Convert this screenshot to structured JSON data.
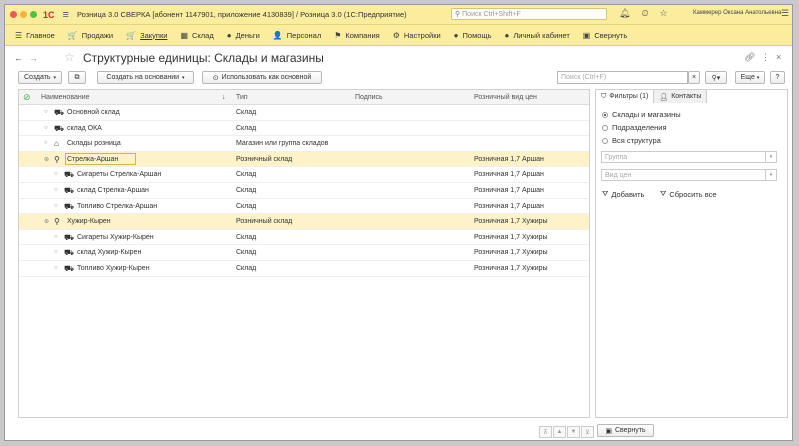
{
  "window": {
    "title": "Розница 3.0 СВЕРКА [абонент 1147901, приложение 4130839] / Розница 3.0  (1С:Предприятие)",
    "search_placeholder": "Поиск Ctrl+Shift+F",
    "user": "Каммерер Оксана Анатольевна"
  },
  "sections": [
    {
      "icon": "☰",
      "label": "Главное"
    },
    {
      "icon": "🛒",
      "label": "Продажи"
    },
    {
      "icon": "🛒",
      "label": "Закупки",
      "active": true
    },
    {
      "icon": "▦",
      "label": "Склад"
    },
    {
      "icon": "●",
      "label": "Деньги"
    },
    {
      "icon": "👤",
      "label": "Персонал"
    },
    {
      "icon": "⚑",
      "label": "Компания"
    },
    {
      "icon": "⚙",
      "label": "Настройки"
    },
    {
      "icon": "●",
      "label": "Помощь"
    },
    {
      "icon": "●",
      "label": "Личный кабинет"
    },
    {
      "icon": "▣",
      "label": "Свернуть"
    }
  ],
  "form": {
    "title": "Структурные единицы: Склады и магазины",
    "create_label": "Создать",
    "create_based_label": "Создать на основании",
    "use_as_main_label": "Использовать как основной",
    "search_placeholder": "Поиск (Ctrl+F)",
    "more_label": "Еще",
    "help_label": "?"
  },
  "table": {
    "columns": {
      "name": "Наименование",
      "type": "Тип",
      "signature": "Подпись",
      "price_type": "Розничный вид цен"
    },
    "rows": [
      {
        "name": "Основной склад",
        "type": "Склад",
        "price": "",
        "level": 0,
        "icon": "warehouse",
        "shop": false
      },
      {
        "name": "склад ОКА",
        "type": "Склад",
        "price": "",
        "level": 0,
        "icon": "warehouse",
        "shop": false
      },
      {
        "name": "Склады розница",
        "type": "Магазин или группа складов",
        "price": "",
        "level": 0,
        "icon": "group",
        "shop": false
      },
      {
        "name": "Стрелка-Аршан",
        "type": "Розничный склад",
        "price": "Розничная 1,7 Аршан",
        "level": 0,
        "icon": "store",
        "shop": true,
        "current": true
      },
      {
        "name": "Сигареты Стрелка-Аршан",
        "type": "Склад",
        "price": "Розничная 1,7 Аршан",
        "level": 1,
        "icon": "warehouse",
        "shop": false
      },
      {
        "name": "склад Стрелка-Аршан",
        "type": "Склад",
        "price": "Розничная 1,7 Аршан",
        "level": 1,
        "icon": "warehouse",
        "shop": false
      },
      {
        "name": "Топливо Стрелка-Аршан",
        "type": "Склад",
        "price": "Розничная 1,7 Аршан",
        "level": 1,
        "icon": "warehouse",
        "shop": false
      },
      {
        "name": "Хужир-Кырен",
        "type": "Розничный склад",
        "price": "Розничная 1,7 Хужиры",
        "level": 0,
        "icon": "store",
        "shop": true
      },
      {
        "name": "Сигареты Хужир-Кырен",
        "type": "Склад",
        "price": "Розничная 1,7 Хужиры",
        "level": 1,
        "icon": "warehouse",
        "shop": false
      },
      {
        "name": "склад Хужир-Кырен",
        "type": "Склад",
        "price": "Розничная 1,7 Хужиры",
        "level": 1,
        "icon": "warehouse",
        "shop": false
      },
      {
        "name": "Топливо Хужир-Кырен",
        "type": "Склад",
        "price": "Розничная 1,7 Хужиры",
        "level": 1,
        "icon": "warehouse",
        "shop": false
      }
    ]
  },
  "panel": {
    "tab_filters": "Фильтры (1)",
    "tab_contacts": "Контакты",
    "radio": [
      "Склады и магазины",
      "Подразделения",
      "Вся структура"
    ],
    "group_placeholder": "Группа",
    "price_placeholder": "Вид цен",
    "add_label": "Добавить",
    "reset_label": "Сбросить все",
    "collapse_label": "Свернуть"
  }
}
